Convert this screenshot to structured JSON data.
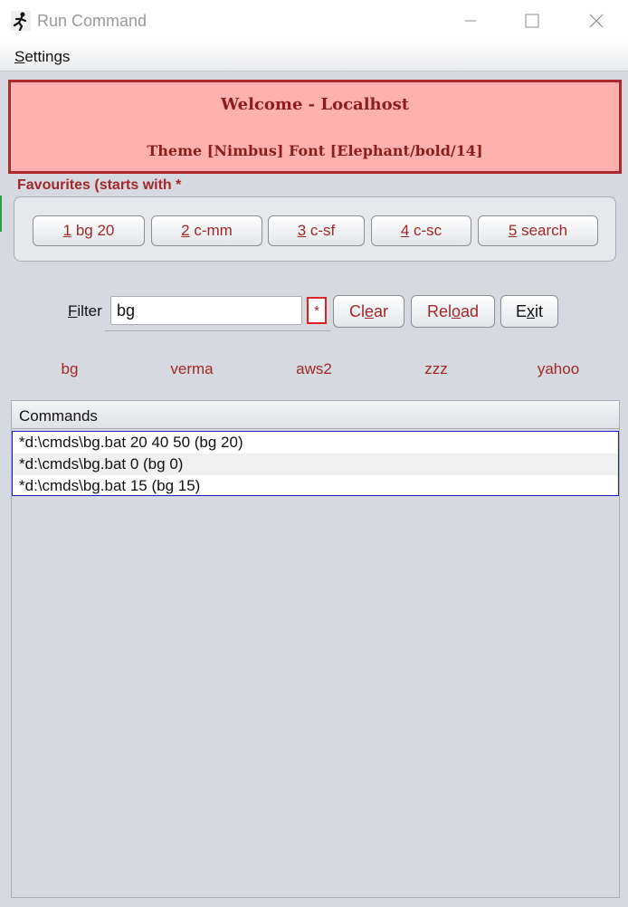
{
  "window": {
    "title": "Run Command",
    "controls": {
      "minimize": "—",
      "maximize": "☐",
      "close": "✕"
    }
  },
  "menu": {
    "settings": {
      "first": "S",
      "rest": "ettings"
    }
  },
  "banner": {
    "title": "Welcome - Localhost",
    "subtitle": "Theme [Nimbus] Font [Elephant/bold/14]",
    "bg_color": "#ffb1b0",
    "border_color": "#b0282a"
  },
  "favourites": {
    "label": "Favourites (starts with *",
    "buttons": [
      {
        "key": "1",
        "text": " bg 20"
      },
      {
        "key": "2",
        "text": " c-mm"
      },
      {
        "key": "3",
        "text": " c-sf"
      },
      {
        "key": "4",
        "text": " c-sc"
      },
      {
        "key": "5",
        "text": " search"
      }
    ]
  },
  "filter": {
    "label_first": "F",
    "label_rest": "ilter",
    "value": "bg",
    "star": "*",
    "clear": {
      "pre": "Cl",
      "ul": "e",
      "post": "ar"
    },
    "reload": {
      "pre": "Rel",
      "ul": "o",
      "post": "ad"
    },
    "exit": {
      "pre": "E",
      "ul": "x",
      "post": "it"
    }
  },
  "quick_links": [
    "bg",
    "verma",
    "aws2",
    "zzz",
    "yahoo"
  ],
  "commands": {
    "header": "Commands",
    "rows": [
      "*d:\\cmds\\bg.bat 20 40 50 (bg 20)",
      "*d:\\cmds\\bg.bat 0 (bg 0)",
      "*d:\\cmds\\bg.bat 15 (bg 15)"
    ]
  },
  "colors": {
    "accent": "#a0282a",
    "panel": "#d6d9df",
    "selection_border": "#1a1ad6"
  }
}
